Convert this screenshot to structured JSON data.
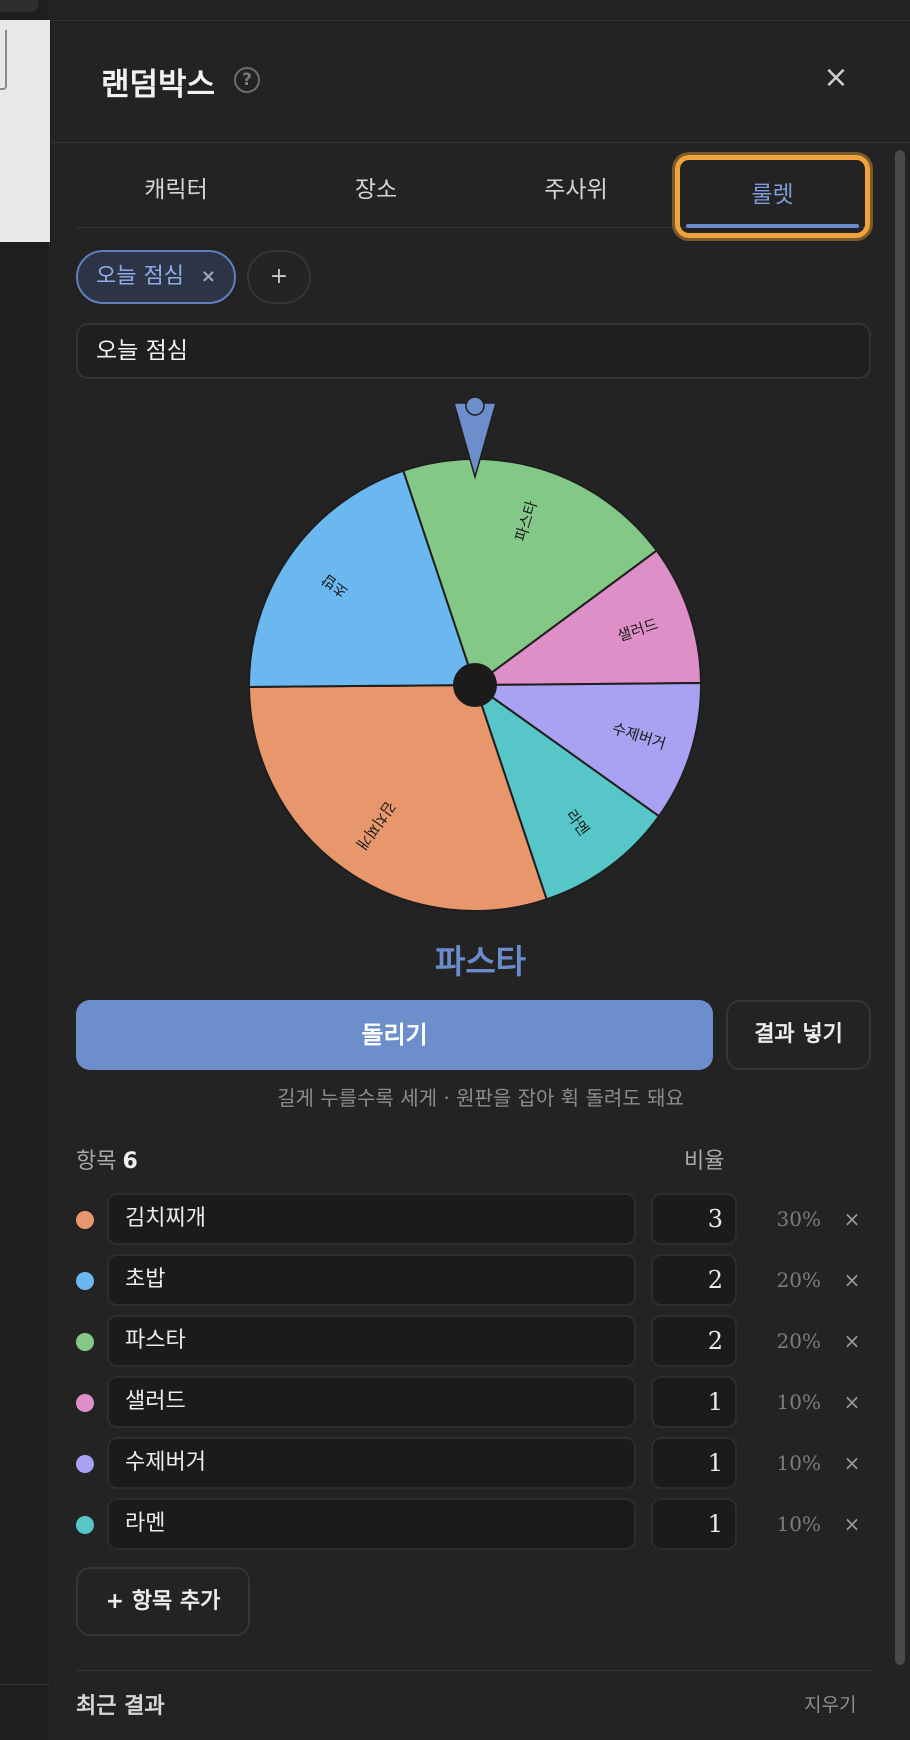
{
  "header": {
    "title": "랜덤박스",
    "help_icon": "question-circle-icon",
    "close_icon": "close-icon",
    "close_glyph": "×"
  },
  "tabs": [
    {
      "label": "캐릭터"
    },
    {
      "label": "장소"
    },
    {
      "label": "주사위"
    },
    {
      "label": "룰렛",
      "active": true
    }
  ],
  "chips": {
    "active_label": "오늘 점심",
    "remove_glyph": "×",
    "add_glyph": "+"
  },
  "roulette_name": {
    "value": "오늘 점심"
  },
  "wheel": {
    "pointer_color": "#6c8fcc",
    "hub_color": "#1b1b1b"
  },
  "result": {
    "text": "파스타"
  },
  "actions": {
    "spin_label": "돌리기",
    "insert_label": "결과 넣기"
  },
  "hint": "길게 누를수록 세게 · 원판을 잡아 휙 돌려도 돼요",
  "list": {
    "items_label": "항목",
    "count": "6",
    "ratio_label": "비율",
    "remove_glyph": "×",
    "items": [
      {
        "name": "김치찌개",
        "weight": "3",
        "percent": "30%",
        "color": "#e8976c"
      },
      {
        "name": "초밥",
        "weight": "2",
        "percent": "20%",
        "color": "#6bb8f0"
      },
      {
        "name": "파스타",
        "weight": "2",
        "percent": "20%",
        "color": "#84c888"
      },
      {
        "name": "샐러드",
        "weight": "1",
        "percent": "10%",
        "color": "#df8fc8"
      },
      {
        "name": "수제버거",
        "weight": "1",
        "percent": "10%",
        "color": "#a9a2f2"
      },
      {
        "name": "라멘",
        "weight": "1",
        "percent": "10%",
        "color": "#57c6c8"
      }
    ]
  },
  "add_item_label": "+ 항목 추가",
  "recent": {
    "title": "최근 결과",
    "clear_label": "지우기"
  }
}
